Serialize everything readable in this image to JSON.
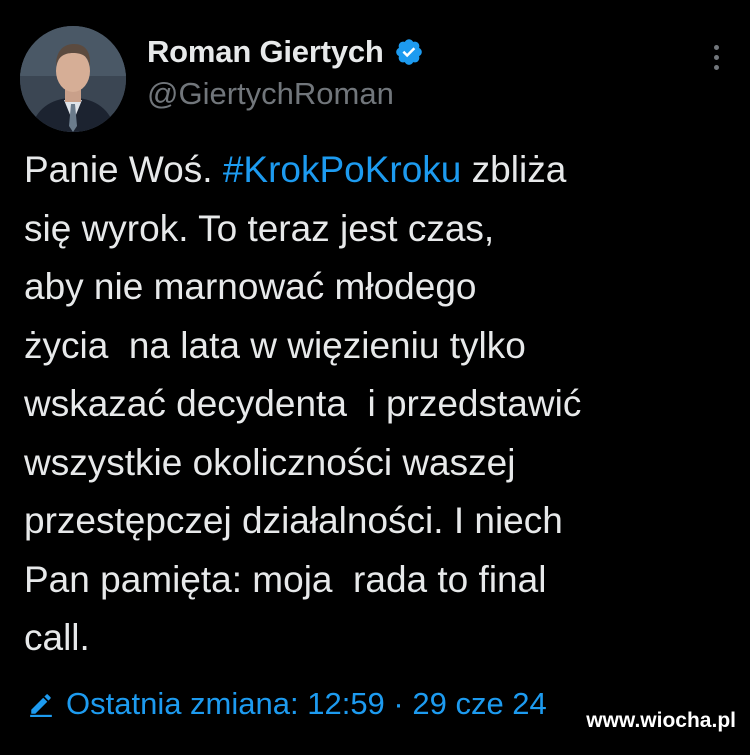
{
  "author": {
    "display_name": "Roman Giertych",
    "handle": "@GiertychRoman",
    "verified": true,
    "verified_icon": "verified-badge-icon",
    "avatar_icon": "avatar-photo"
  },
  "tweet": {
    "lines": [
      [
        "Panie Woś. ",
        "#KrokPoKroku",
        " zbliża"
      ],
      [
        "się wyrok. To teraz jest czas,"
      ],
      [
        "aby nie marnować młodego"
      ],
      [
        "życia  na lata w więzieniu tylko"
      ],
      [
        "wskazać decydenta  i przedstawić"
      ],
      [
        "wszystkie okoliczności waszej"
      ],
      [
        "przestępczej działalności. I niech"
      ],
      [
        "Pan pamięta: moja  rada to final"
      ],
      [
        "call."
      ]
    ],
    "hashtag": "#KrokPoKroku"
  },
  "meta": {
    "edit_icon": "pencil-edit-icon",
    "last_edit_label": "Ostatnia zmiana: 12:59 · 29 cze 24"
  },
  "more_icon": "more-options-icon",
  "watermark": "www.wiocha.pl",
  "colors": {
    "background": "#000000",
    "text": "#e7e9ea",
    "secondary": "#71767b",
    "accent": "#1d9bf0"
  }
}
